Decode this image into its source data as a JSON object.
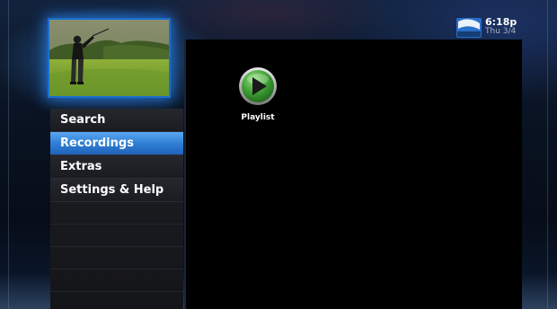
{
  "status_bar": {
    "brand": "DIRECTV",
    "time": "6:18p",
    "date": "Thu 3/4"
  },
  "preview": {
    "content": "golfer swinging on fairway"
  },
  "menu": {
    "items": [
      {
        "label": "Search",
        "selected": false
      },
      {
        "label": "Recordings",
        "selected": true
      },
      {
        "label": "Extras",
        "selected": false
      },
      {
        "label": "Settings & Help",
        "selected": false
      }
    ]
  },
  "content": {
    "tiles": [
      {
        "label": "Playlist",
        "icon": "play-icon"
      }
    ]
  },
  "colors": {
    "accent": "#2f7fd6",
    "tile_green": "#2e8a2a",
    "background": "#0a1424"
  }
}
